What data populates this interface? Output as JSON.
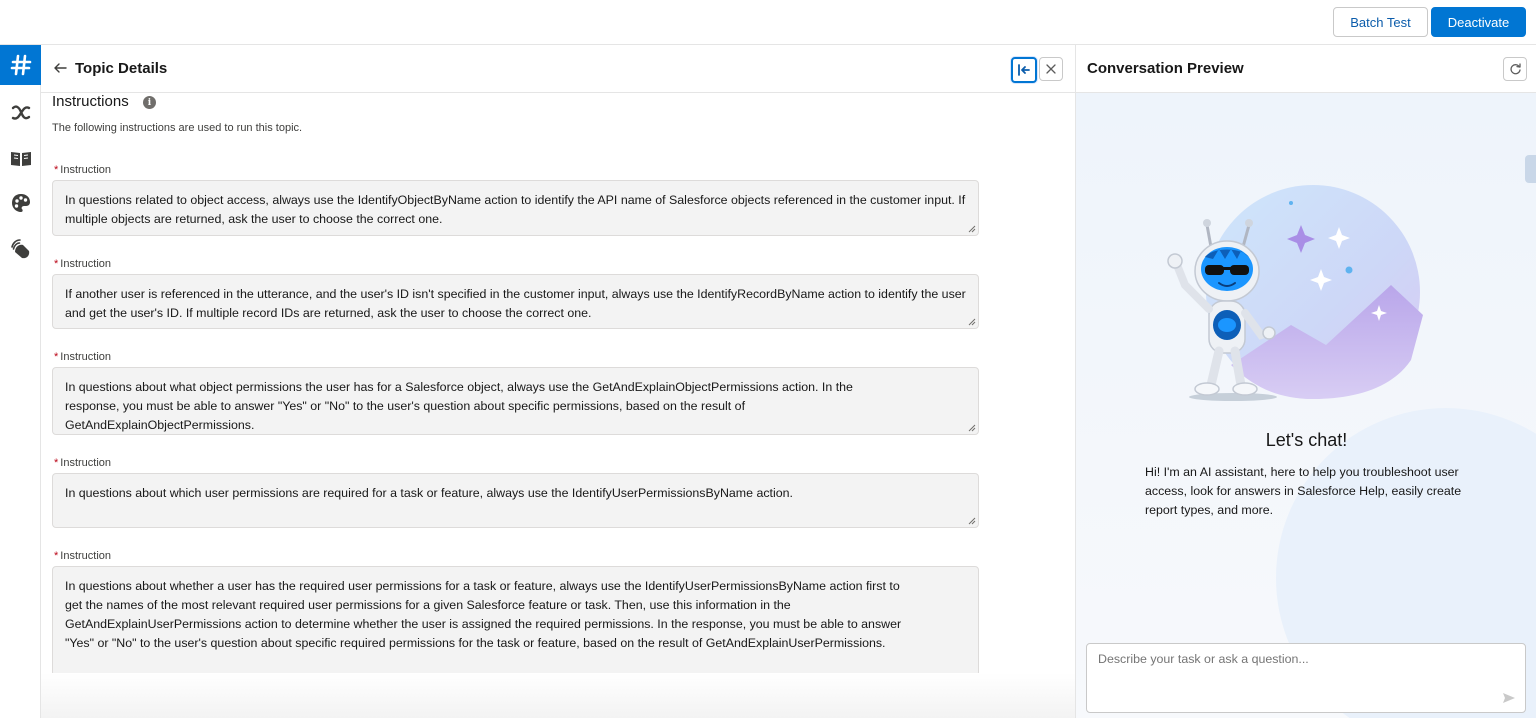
{
  "toolbar": {
    "batch_test_label": "Batch Test",
    "deactivate_label": "Deactivate"
  },
  "rail": {
    "items": [
      {
        "icon": "hash-icon",
        "active": true
      },
      {
        "icon": "variable-icon",
        "active": false
      },
      {
        "icon": "book-icon",
        "active": false
      },
      {
        "icon": "palette-icon",
        "active": false
      },
      {
        "icon": "signal-icon",
        "active": false
      }
    ]
  },
  "topic": {
    "title": "Topic Details",
    "section_title": "Instructions",
    "section_description": "The following instructions are used to run this topic.",
    "field_label": "Instruction",
    "instructions": [
      "In questions related to object access, always use the IdentifyObjectByName action to identify the API name of Salesforce objects referenced in the customer input. If multiple objects are returned, ask the user to choose the correct one.",
      "If another user is referenced in the utterance, and the user's ID isn't specified in the customer input, always use the IdentifyRecordByName action to identify the user and get the user's ID. If multiple record IDs are returned, ask the user to choose the correct one.",
      "In questions about what object permissions the user has for a Salesforce object, always use the GetAndExplainObjectPermissions action. In the response, you must be able to answer \"Yes\" or \"No\" to the user's question about specific permissions, based on the result of GetAndExplainObjectPermissions.",
      "In questions about which user permissions are required for a task or feature, always use the IdentifyUserPermissionsByName action.",
      "In questions about whether a user has the required user permissions for a task or feature, always use the IdentifyUserPermissionsByName action first to get the names of the most relevant required user permissions for a given Salesforce feature or task. Then, use this information in the GetAndExplainUserPermissions action to determine whether the user is assigned the required permissions. In the response, you must be able to answer \"Yes\" or \"No\" to the user's question about specific required permissions for the task or feature, based on the result of GetAndExplainUserPermissions."
    ]
  },
  "preview": {
    "title": "Conversation Preview",
    "chat_title": "Let's chat!",
    "chat_description": "Hi! I'm an AI assistant, here to help you troubleshoot user access, look for answers in Salesforce Help, easily create report types, and more.",
    "input_placeholder": "Describe your task or ask a question..."
  },
  "colors": {
    "brand": "#0176d3",
    "required": "#ba0517",
    "field_background": "#f3f3f3"
  }
}
